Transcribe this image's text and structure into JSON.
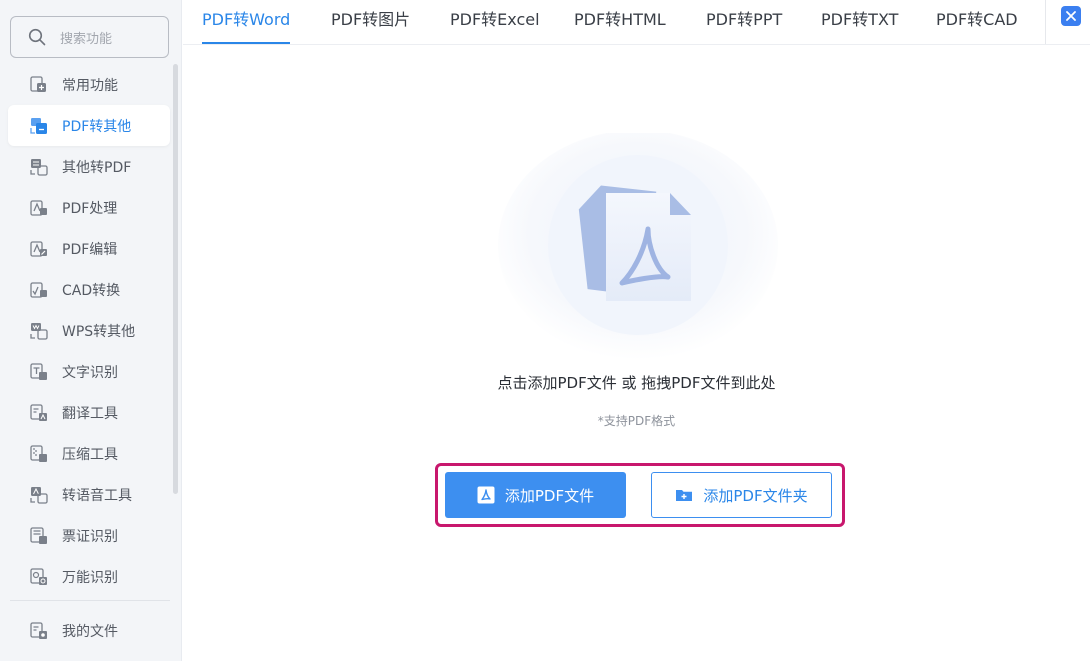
{
  "search": {
    "placeholder": "搜索功能",
    "icon": "search-icon"
  },
  "sidebar": {
    "items": [
      {
        "label": "常用功能",
        "icon": "common-functions-icon"
      },
      {
        "label": "PDF转其他",
        "icon": "pdf-to-other-icon",
        "active": true
      },
      {
        "label": "其他转PDF",
        "icon": "other-to-pdf-icon"
      },
      {
        "label": "PDF处理",
        "icon": "pdf-process-icon"
      },
      {
        "label": "PDF编辑",
        "icon": "pdf-edit-icon"
      },
      {
        "label": "CAD转换",
        "icon": "cad-convert-icon"
      },
      {
        "label": "WPS转其他",
        "icon": "wps-convert-icon"
      },
      {
        "label": "文字识别",
        "icon": "text-recognition-icon"
      },
      {
        "label": "翻译工具",
        "icon": "translate-icon"
      },
      {
        "label": "压缩工具",
        "icon": "compress-icon"
      },
      {
        "label": "转语音工具",
        "icon": "text-to-speech-icon"
      },
      {
        "label": "票证识别",
        "icon": "ticket-recognition-icon"
      },
      {
        "label": "万能识别",
        "icon": "universal-recognition-icon"
      }
    ],
    "my_files": {
      "label": "我的文件",
      "icon": "my-files-icon"
    }
  },
  "tabs": [
    {
      "label": "PDF转Word",
      "active": true
    },
    {
      "label": "PDF转图片"
    },
    {
      "label": "PDF转Excel"
    },
    {
      "label": "PDF转HTML"
    },
    {
      "label": "PDF转PPT"
    },
    {
      "label": "PDF转TXT"
    },
    {
      "label": "PDF转CAD"
    }
  ],
  "main": {
    "prompt": "点击添加PDF文件 或 拖拽PDF文件到此处",
    "hint": "*支持PDF格式",
    "add_file_label": "添加PDF文件",
    "add_folder_label": "添加PDF文件夹"
  },
  "colors": {
    "accent": "#2a86e8",
    "primary_button": "#3d8ff0",
    "highlight_border": "#c8176d",
    "sidebar_bg": "#f3f5f8"
  }
}
